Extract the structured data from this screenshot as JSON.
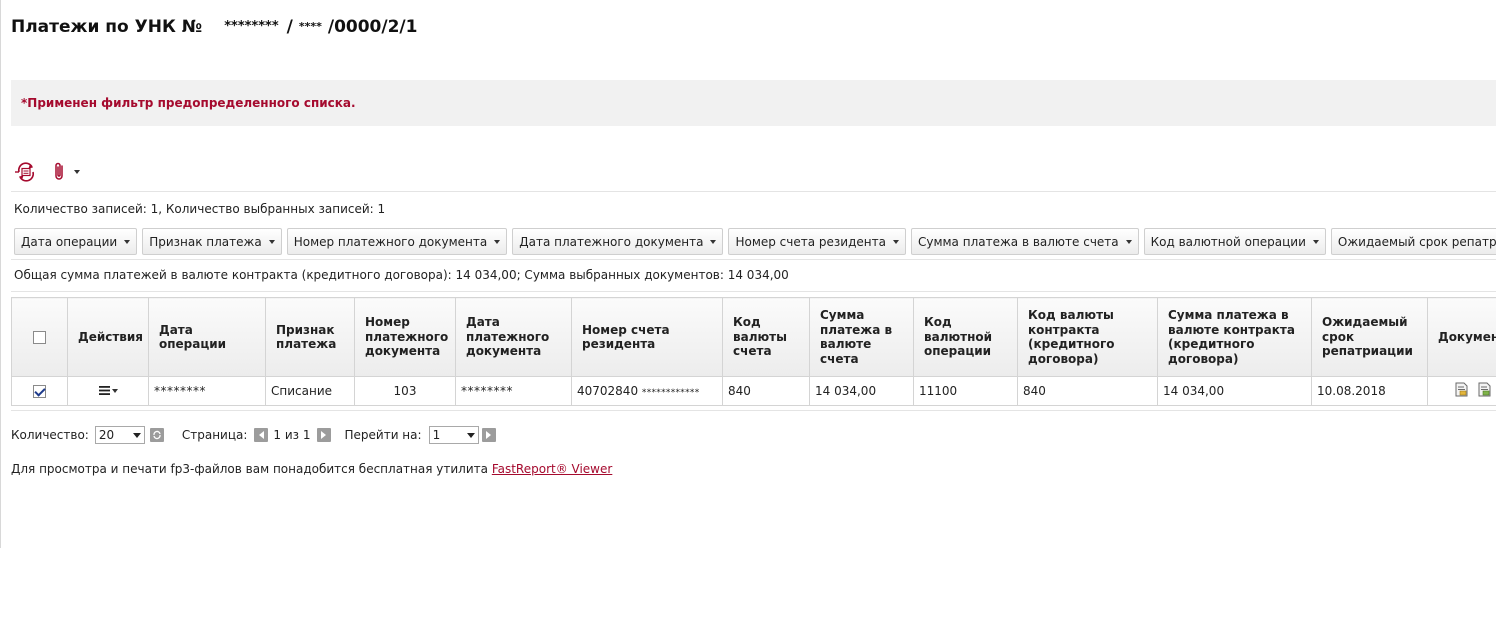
{
  "page": {
    "title_prefix": "Платежи по УНК №",
    "title_mask1": "********",
    "title_sep": "/",
    "title_mask2": "****",
    "title_suffix": "/0000/2/1"
  },
  "filter_notice": "*Применен фильтр предопределенного списка.",
  "toolbar": {
    "icons": [
      "refresh-document-icon",
      "paperclip-icon",
      "chevron-down-icon"
    ]
  },
  "records_info": "Количество записей: 1, Количество выбранных записей: 1",
  "sort_buttons": [
    "Дата операции",
    "Признак платежа",
    "Номер платежного документа",
    "Дата платежного документа",
    "Номер счета резидента",
    "Сумма платежа в валюте счета",
    "Код валютной операции",
    "Ожидаемый срок репатриации"
  ],
  "sum_info": "Общая сумма платежей в валюте контракта (кредитного договора): 14 034,00; Сумма выбранных документов: 14 034,00",
  "table": {
    "headers": {
      "actions": "Действия",
      "op_date": "Дата операции",
      "pay_sign": "Признак платежа",
      "doc_num": "Номер платежного документа",
      "doc_date": "Дата платежного документа",
      "account": "Номер счета резидента",
      "acc_currency": "Код валюты счета",
      "amount_acc": "Сумма платежа в валюте счета",
      "op_code": "Код валютной операции",
      "contract_currency": "Код валюты контракта (кредитного договора)",
      "amount_contract": "Сумма платежа в валюте контракта (кредитного договора)",
      "repatriation": "Ожидаемый срок репатриации",
      "documents": "Документы"
    },
    "rows": [
      {
        "checked": true,
        "op_date": "********",
        "pay_sign": "Списание",
        "doc_num": "103",
        "doc_date": "********",
        "account_prefix": "40702840",
        "account_mask": "************",
        "acc_currency": "840",
        "amount_acc": "14 034,00",
        "op_code": "11100",
        "contract_currency": "840",
        "amount_contract": "14 034,00",
        "repatriation": "10.08.2018"
      }
    ]
  },
  "pager": {
    "count_label": "Количество:",
    "count_value": "20",
    "page_label": "Страница:",
    "page_info": "1 из 1",
    "goto_label": "Перейти на:",
    "goto_value": "1"
  },
  "footer": {
    "text": "Для просмотра и печати fp3-файлов вам понадобится бесплатная утилита",
    "link": "FastReport® Viewer"
  }
}
